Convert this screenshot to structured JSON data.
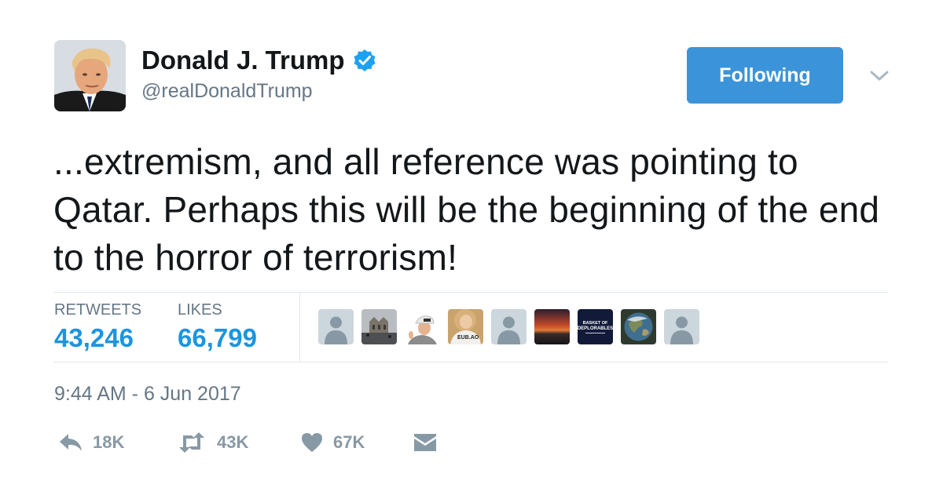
{
  "user": {
    "name": "Donald J. Trump",
    "handle": "@realDonaldTrump",
    "verified": true,
    "avatar_icon": "profile-photo"
  },
  "follow_button": {
    "label": "Following",
    "color": "#3b94d9"
  },
  "menu_icon": "chevron-down-icon",
  "tweet": {
    "text": "...extremism, and all reference was pointing to Qatar. Perhaps this will be the beginning of the end to the horror of terrorism!"
  },
  "stats": {
    "retweets_label": "RETWEETS",
    "retweets_value": "43,246",
    "likes_label": "LIKES",
    "likes_value": "66,799"
  },
  "likers": [
    {
      "name": "default-avatar-1",
      "kind": "default"
    },
    {
      "name": "building-photo-avatar",
      "kind": "photo"
    },
    {
      "name": "cap-man-avatar",
      "kind": "photo"
    },
    {
      "name": "woman-shirt-avatar",
      "kind": "photo"
    },
    {
      "name": "default-avatar-2",
      "kind": "default"
    },
    {
      "name": "sunset-avatar",
      "kind": "photo"
    },
    {
      "name": "basket-of-deplorables-avatar",
      "kind": "logo",
      "text": "BASKET OF DEPLORABLES"
    },
    {
      "name": "earth-avatar",
      "kind": "photo"
    },
    {
      "name": "default-avatar-3",
      "kind": "default"
    }
  ],
  "timestamp": "9:44 AM - 6 Jun 2017",
  "actions": {
    "reply": {
      "icon": "reply-icon",
      "count": "18K"
    },
    "retweet": {
      "icon": "retweet-icon",
      "count": "43K"
    },
    "like": {
      "icon": "heart-icon",
      "count": "67K"
    },
    "message": {
      "icon": "envelope-icon"
    }
  },
  "colors": {
    "accent": "#1b95e0",
    "muted": "#657786",
    "action_gray": "#8899a6",
    "divider": "#e1e8ed"
  }
}
